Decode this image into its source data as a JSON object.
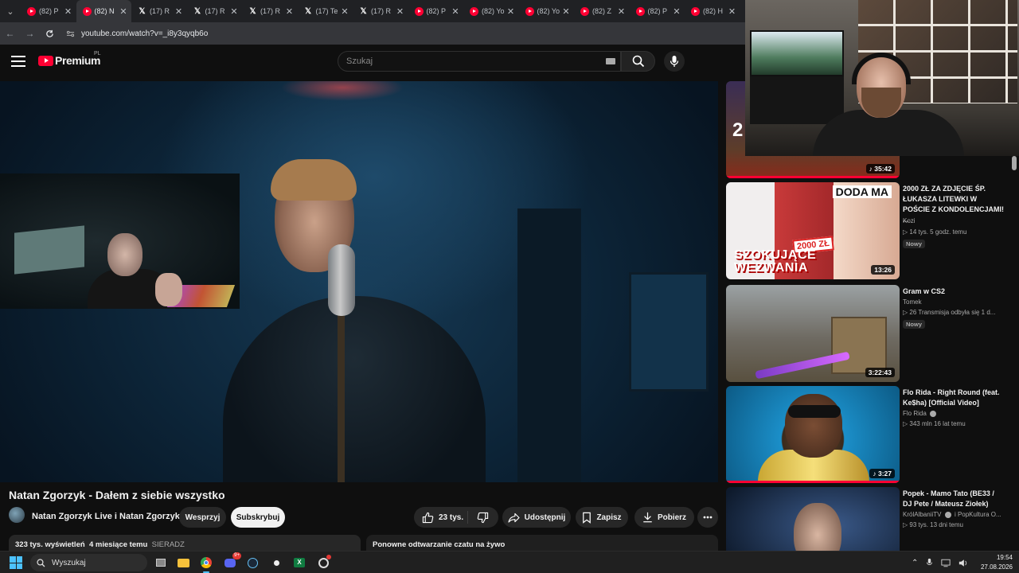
{
  "browser": {
    "tabs": [
      {
        "icon": "youtube-icon",
        "label": "(82) P",
        "active": false
      },
      {
        "icon": "youtube-icon",
        "label": "(82) N",
        "active": true
      },
      {
        "icon": "x-icon",
        "label": "(17) R",
        "active": false
      },
      {
        "icon": "x-icon",
        "label": "(17) R",
        "active": false
      },
      {
        "icon": "x-icon",
        "label": "(17) R",
        "active": false
      },
      {
        "icon": "x-icon",
        "label": "(17) Te",
        "active": false
      },
      {
        "icon": "x-icon",
        "label": "(17) R",
        "active": false
      },
      {
        "icon": "youtube-icon",
        "label": "(82) P",
        "active": false
      },
      {
        "icon": "youtube-icon",
        "label": "(82) Yo",
        "active": false
      },
      {
        "icon": "youtube-icon",
        "label": "(82) Yo",
        "active": false
      },
      {
        "icon": "youtube-icon",
        "label": "(82) Z",
        "active": false
      },
      {
        "icon": "youtube-icon",
        "label": "(82) P",
        "active": false
      },
      {
        "icon": "youtube-icon",
        "label": "(82) H",
        "active": false
      }
    ],
    "url": "youtube.com/watch?v=_i8y3qyqb6o"
  },
  "youtube": {
    "logo_text": "Premium",
    "country_code": "PL",
    "search_placeholder": "Szukaj"
  },
  "video": {
    "title": "Natan Zgorzyk - Dałem z siebie wszystko",
    "channel": "Natan Zgorzyk Live i Natan Zgorzyk",
    "support_label": "Wesprzyj",
    "subscribe_label": "Subskrybuj",
    "likes": "23 tys.",
    "share_label": "Udostępnij",
    "save_label": "Zapisz",
    "download_label": "Pobierz",
    "views": "323 tys. wyświetleń",
    "age": "4 miesiące temu",
    "tag": "SIERADZ",
    "chat_replay": "Ponowne odtwarzanie czatu na żywo"
  },
  "recommendations": [
    {
      "title": "",
      "channel": "",
      "meta": "",
      "duration": "35:42",
      "new": "",
      "thumb_text": "2"
    },
    {
      "title": "2000 ZŁ ZA ZDJĘCIE ŚP. ŁUKASZA LITEWKI W POŚCIE Z KONDOLENCJAMI! ...",
      "channel": "Kozi",
      "meta": "14 tys.   5 godz. temu",
      "duration": "13:26",
      "new": "Nowy",
      "thumb_text": "SZOKUJĄCE WEZWANIA",
      "thumb_top": "DODA MA",
      "thumb_price": "2000 ZŁ"
    },
    {
      "title": "Gram  w CS2",
      "channel": "Tomek",
      "meta": "26   Transmisja odbyła się 1 d...",
      "duration": "3:22:43",
      "new": "Nowy"
    },
    {
      "title": "Flo Rida - Right Round (feat. Ke$ha) [Official Video]",
      "channel": "Flo Rida",
      "meta": "343 mln   16 lat temu",
      "duration": "3:27",
      "new": ""
    },
    {
      "title": "Popek - Mamo Tato (BE33 / DJ Pete / Mateusz Ziołek)",
      "channel": "KrólAlbaniiTV",
      "channel_extra": "i PopKultura O...",
      "meta": "93 tys.   13 dni temu",
      "duration": "",
      "new": ""
    }
  ],
  "taskbar": {
    "search_label": "Wyszukaj",
    "time": "19:54",
    "date": "27.08.2026",
    "discord_badge": "9+"
  }
}
